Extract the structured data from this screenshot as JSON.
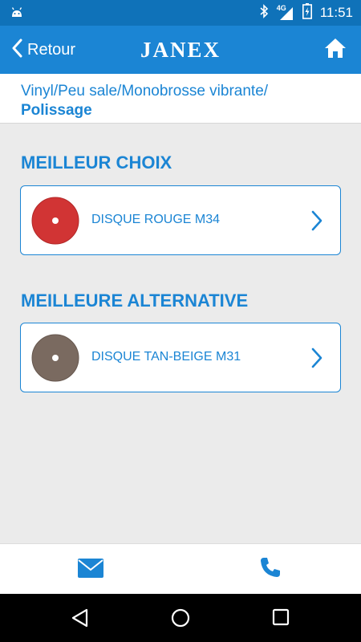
{
  "status_bar": {
    "network": "4G",
    "time": "11:51",
    "icons": [
      "android-icon",
      "bluetooth-icon",
      "signal-icon",
      "battery-icon"
    ]
  },
  "app_bar": {
    "back_label": "Retour",
    "brand": "JANEX",
    "icons": [
      "chevron-left-icon",
      "home-icon"
    ]
  },
  "breadcrumb": {
    "path": "Vinyl/Peu sale/Monobrosse vibrante/",
    "current": "Polissage"
  },
  "sections": [
    {
      "title": "MEILLEUR CHOIX",
      "product": {
        "name": "DISQUE ROUGE M34",
        "disc_color": "#d13434",
        "icon": "red-disc-icon"
      }
    },
    {
      "title": "MEILLEURE ALTERNATIVE",
      "product": {
        "name": "DISQUE TAN-BEIGE M31",
        "disc_color": "#7a6a60",
        "icon": "tan-disc-icon"
      }
    }
  ],
  "bottom_bar": {
    "icons": [
      "mail-icon",
      "phone-icon"
    ]
  },
  "nav_bar": {
    "icons": [
      "back-triangle-icon",
      "home-circle-icon",
      "recents-square-icon"
    ]
  },
  "colors": {
    "status_bar": "#0f72b9",
    "app_bar": "#1b85d4",
    "accent": "#1b85d4",
    "background": "#ebebeb"
  }
}
